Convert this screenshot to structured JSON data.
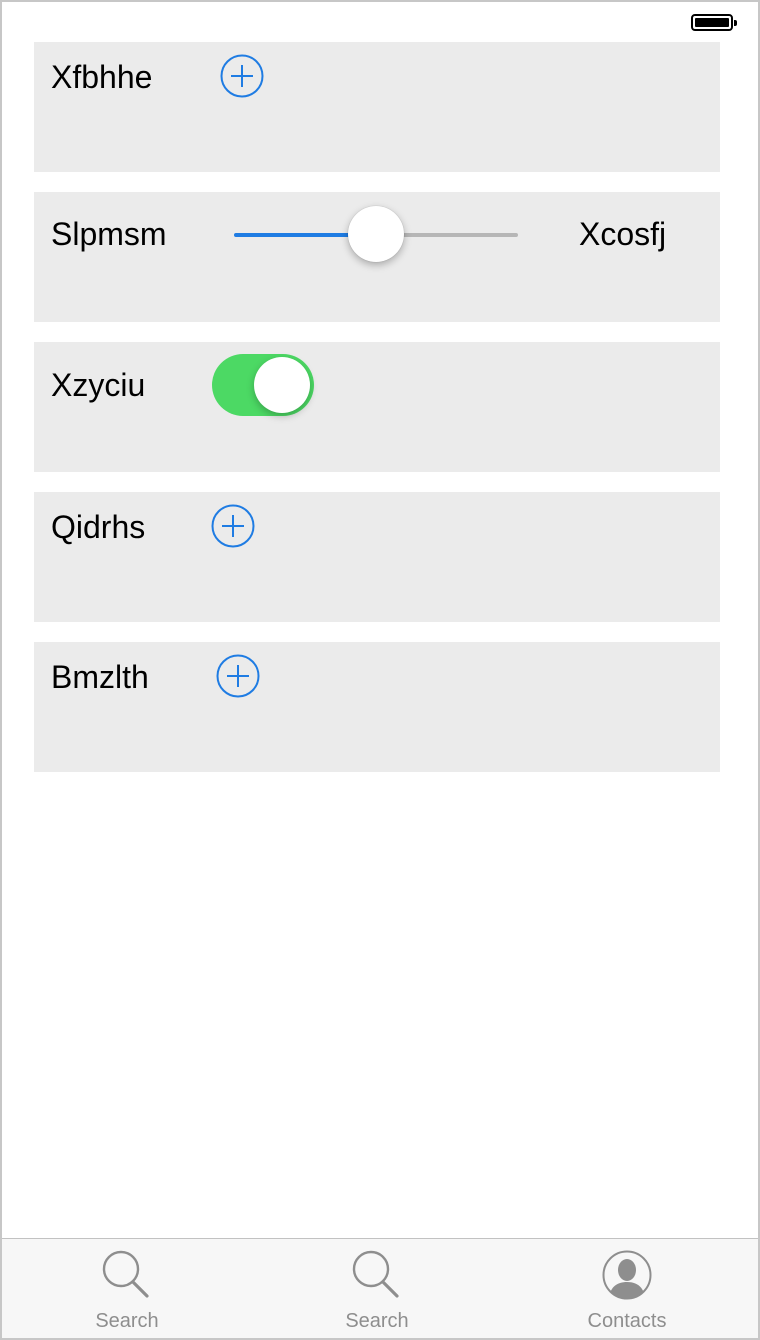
{
  "status_bar": {
    "battery_icon": "battery-full-icon"
  },
  "rows": [
    {
      "label": "Xfbhhe",
      "control": "add-button",
      "icon": "plus-circle-icon"
    },
    {
      "label": "Slpmsm",
      "control": "slider",
      "value": 0.5,
      "right_label": "Xcosfj"
    },
    {
      "label": "Xzyciu",
      "control": "toggle",
      "on": true
    },
    {
      "label": "Qidrhs",
      "control": "add-button",
      "icon": "plus-circle-icon"
    },
    {
      "label": "Bmzlth",
      "control": "add-button",
      "icon": "plus-circle-icon"
    }
  ],
  "tab_bar": {
    "tabs": [
      {
        "label": "Search",
        "icon": "search-icon"
      },
      {
        "label": "Search",
        "icon": "search-icon"
      },
      {
        "label": "Contacts",
        "icon": "contact-avatar-icon"
      }
    ]
  },
  "colors": {
    "accent": "#1f7ce3",
    "toggle_on": "#4cd964",
    "row_background": "#ebebeb",
    "tab_inactive": "#8e8e8e"
  }
}
